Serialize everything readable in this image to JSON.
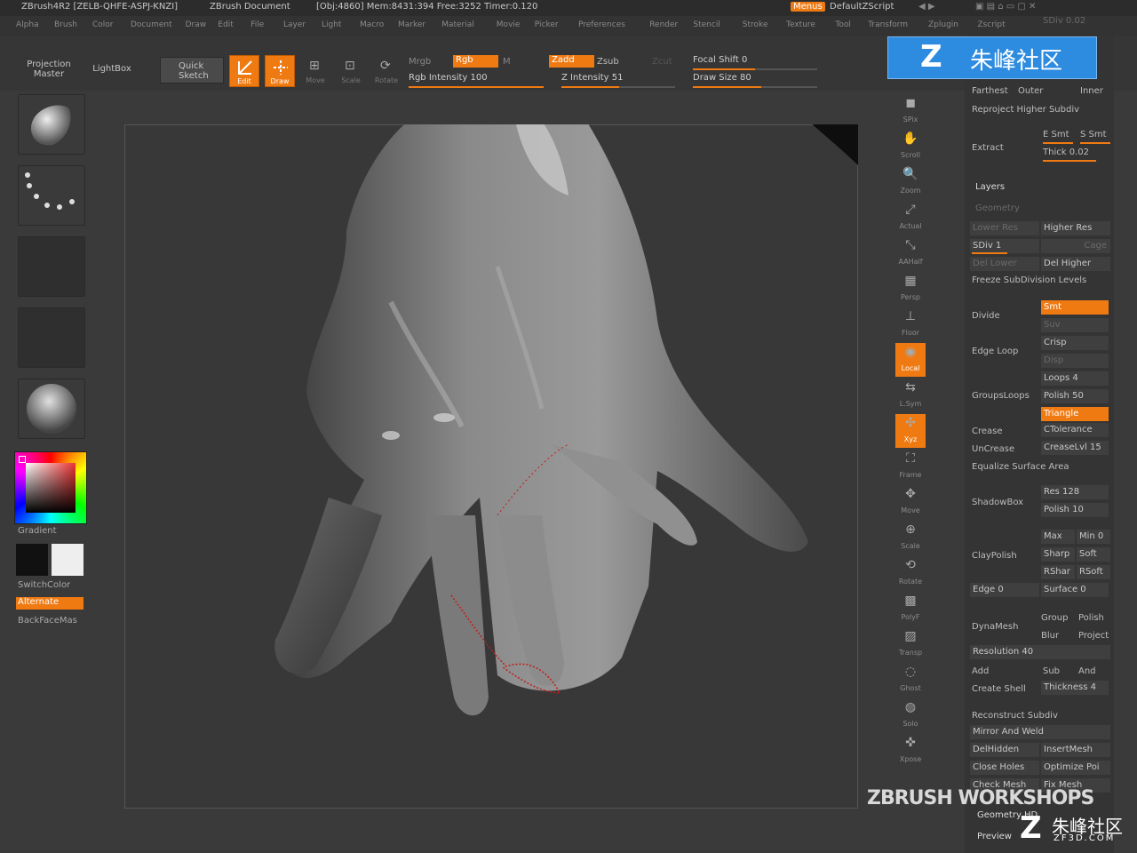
{
  "titlebar": {
    "app": "ZBrush4R2 [ZELB-QHFE-ASPJ-KNZI]",
    "doc": "ZBrush Document",
    "stats": "[Obj:4860] Mem:8431:394 Free:3252 Timer:0.120",
    "menus_btn": "Menus",
    "script": "DefaultZScript"
  },
  "menubar": [
    "Alpha",
    "Brush",
    "Color",
    "Document",
    "Draw",
    "Edit",
    "File",
    "Layer",
    "Light",
    "Macro",
    "Marker",
    "Material",
    "Movie",
    "Picker",
    "Preferences",
    "Render",
    "Stencil",
    "Stroke",
    "Texture",
    "Tool",
    "Transform",
    "Zplugin",
    "Zscript"
  ],
  "shelf": {
    "projection_master": "Projection Master",
    "lightbox": "LightBox",
    "quick_sketch": "Quick Sketch",
    "edit": "Edit",
    "draw": "Draw",
    "move": "Move",
    "scale": "Scale",
    "rotate": "Rotate",
    "mrgb": "Mrgb",
    "rgb": "Rgb",
    "m": "M",
    "zadd": "Zadd",
    "zsub": "Zsub",
    "zcut": "Zcut",
    "rgb_intensity": "Rgb Intensity 100",
    "z_intensity": "Z Intensity 51",
    "focal_shift": "Focal Shift 0",
    "draw_size": "Draw Size 80",
    "rgb_intensity_value": 1.0,
    "z_intensity_value": 0.51,
    "focal_shift_value": 0.5,
    "draw_size_value": 0.55
  },
  "left": {
    "gradient": "Gradient",
    "switchcolor": "SwitchColor",
    "alternate": "Alternate",
    "backfacemas": "BackFaceMas"
  },
  "righttools": [
    "SPix",
    "Scroll",
    "Zoom",
    "Actual",
    "AAHalf",
    "Persp",
    "Floor",
    "Local",
    "L.Sym",
    "Xyz",
    "Frame",
    "Move",
    "Scale",
    "Rotate",
    "PolyF",
    "Transp",
    "Ghost",
    "Solo",
    "Xpose"
  ],
  "palette": {
    "top_value": "SDiv 0.02",
    "farthest": "Farthest",
    "outer": "Outer",
    "inner": "Inner",
    "reproject": "Reproject Higher Subdiv",
    "extract": "Extract",
    "e_smt": "E Smt",
    "s_smt": "S Smt",
    "thick": "Thick 0.02",
    "layers": "Layers",
    "geometry": "Geometry",
    "lower_res": "Lower Res",
    "higher_res": "Higher Res",
    "sdiv": "SDiv 1",
    "cage": "Cage",
    "del_lower": "Del Lower",
    "del_higher": "Del Higher",
    "freeze": "Freeze SubDivision Levels",
    "divide": "Divide",
    "smt": "Smt",
    "suv": "Suv",
    "edge_loop": "Edge Loop",
    "crisp": "Crisp",
    "disp": "Disp",
    "grouploops": "GroupsLoops",
    "loops": "Loops 4",
    "polish": "Polish 50",
    "triangle": "Triangle",
    "crease": "Crease",
    "ctolerance": "CTolerance",
    "uncrease": "UnCrease",
    "creaselvl": "CreaseLvl 15",
    "equalize": "Equalize Surface Area",
    "shadowbox": "ShadowBox",
    "res": "Res 128",
    "polish2": "Polish 10",
    "claypolish": "ClayPolish",
    "max": "Max",
    "min": "Min 0",
    "sharp": "Sharp",
    "soft": "Soft",
    "rshar": "RShar",
    "rsoft": "RSoft",
    "edge": "Edge 0",
    "surface": "Surface 0",
    "dynamesh": "DynaMesh",
    "group": "Group",
    "polish3": "Polish",
    "blur": "Blur",
    "project": "Project",
    "resolution": "Resolution 40",
    "add": "Add",
    "sub": "Sub",
    "and": "And",
    "create_shell": "Create Shell",
    "thickness": "Thickness 4",
    "reconstruct": "Reconstruct Subdiv",
    "mirror_weld": "Mirror And Weld",
    "delhidden": "DelHidden",
    "insertmesh": "InsertMesh",
    "close_holes": "Close Holes",
    "optimize": "Optimize Poi",
    "check_mesh": "Check Mesh",
    "fix_mesh": "Fix Mesh",
    "geometry_hd": "Geometry HD",
    "preview": "Preview"
  },
  "watermark": {
    "top": "朱峰社区",
    "workshops": "ZBRUSH WORKSHOPS",
    "bottom": "朱峰社区",
    "bottom_url": "ZF3D.COM"
  }
}
